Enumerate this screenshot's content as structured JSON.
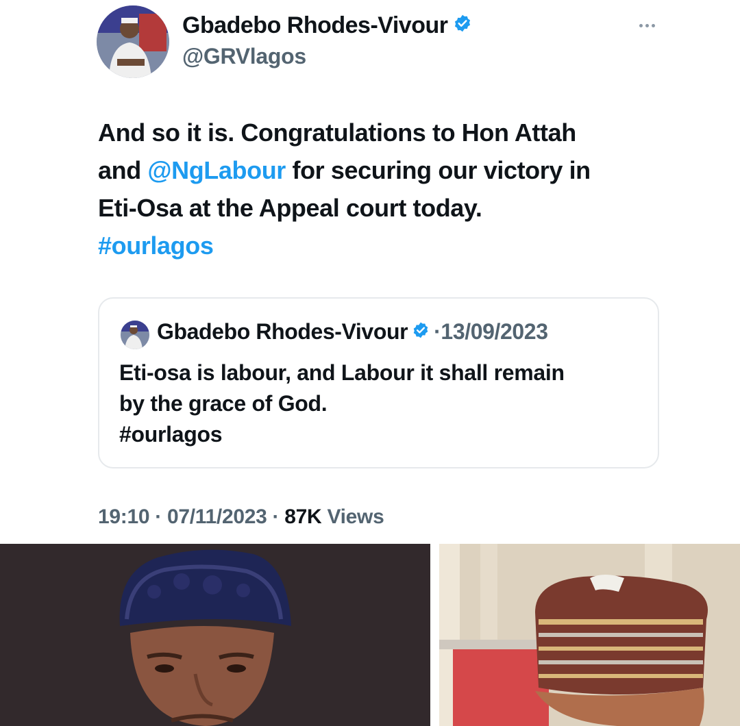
{
  "author": {
    "display_name": "Gbadebo Rhodes-Vivour",
    "handle": "@GRVlagos",
    "verified_icon": "verified-badge-icon"
  },
  "tweet": {
    "lines": [
      "And so it is. Congratulations to Hon Attah",
      {
        "before": "and ",
        "mention": "@NgLabour",
        "after": " for securing our victory in"
      },
      "Eti-Osa at the Appeal court today.",
      "#ourlagos"
    ]
  },
  "quote": {
    "display_name": "Gbadebo Rhodes-Vivour",
    "date": "·13/09/2023",
    "lines": [
      "Eti-osa is labour, and Labour it shall remain",
      "by the grace of God.",
      "#ourlagos"
    ]
  },
  "meta": {
    "time": "19:10",
    "date": "07/11/2023",
    "views_count": "87K",
    "views_label": "Views",
    "separator": " · "
  },
  "colors": {
    "link": "#1d9bf0",
    "muted": "#536471",
    "text": "#0f1419",
    "border": "#e6e9ec"
  }
}
